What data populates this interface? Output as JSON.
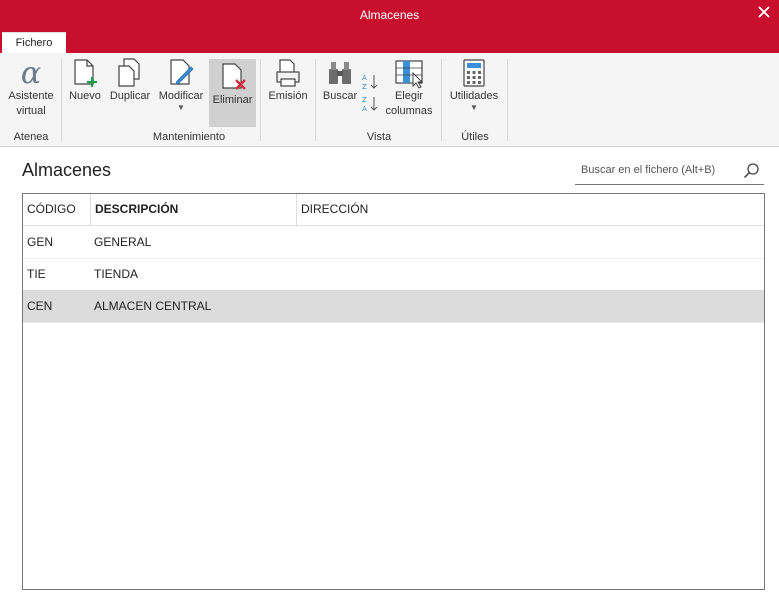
{
  "window": {
    "title": "Almacenes",
    "close_icon": "close-icon"
  },
  "tabs": [
    {
      "label": "Fichero"
    }
  ],
  "ribbon": {
    "groups": [
      {
        "label": "Atenea"
      },
      {
        "label": "Mantenimiento"
      },
      {
        "label": "Vista"
      },
      {
        "label": "Útiles"
      }
    ],
    "buttons": {
      "asistente": {
        "line1": "Asistente",
        "line2": "virtual",
        "icon": "alpha-icon"
      },
      "nuevo": {
        "label": "Nuevo",
        "icon": "new-document-icon"
      },
      "duplicar": {
        "label": "Duplicar",
        "icon": "duplicate-icon"
      },
      "modificar": {
        "label": "Modificar",
        "icon": "edit-document-icon"
      },
      "eliminar": {
        "label": "Eliminar",
        "icon": "delete-document-icon"
      },
      "emision": {
        "label": "Emisión",
        "icon": "print-icon"
      },
      "buscar": {
        "label": "Buscar",
        "icon": "binoculars-icon"
      },
      "elegir": {
        "line1": "Elegir",
        "line2": "columnas",
        "icon": "columns-icon"
      },
      "utilidades": {
        "label": "Utilidades",
        "icon": "calculator-icon"
      }
    },
    "sort_icons": [
      "sort-az-icon",
      "sort-za-icon"
    ]
  },
  "page": {
    "title": "Almacenes"
  },
  "search": {
    "placeholder": "Buscar en el fichero (Alt+B)"
  },
  "table": {
    "columns": [
      "CÓDIGO",
      "DESCRIPCIÓN",
      "DIRECCIÓN"
    ],
    "rows": [
      {
        "codigo": "GEN",
        "descripcion": "GENERAL",
        "direccion": ""
      },
      {
        "codigo": "TIE",
        "descripcion": "TIENDA",
        "direccion": ""
      },
      {
        "codigo": "CEN",
        "descripcion": "ALMACEN CENTRAL",
        "direccion": "",
        "selected": true
      }
    ]
  },
  "colors": {
    "accent": "#c8102e",
    "ribbon_bg": "#f5f5f5",
    "selected_row": "#dcdcdc"
  }
}
